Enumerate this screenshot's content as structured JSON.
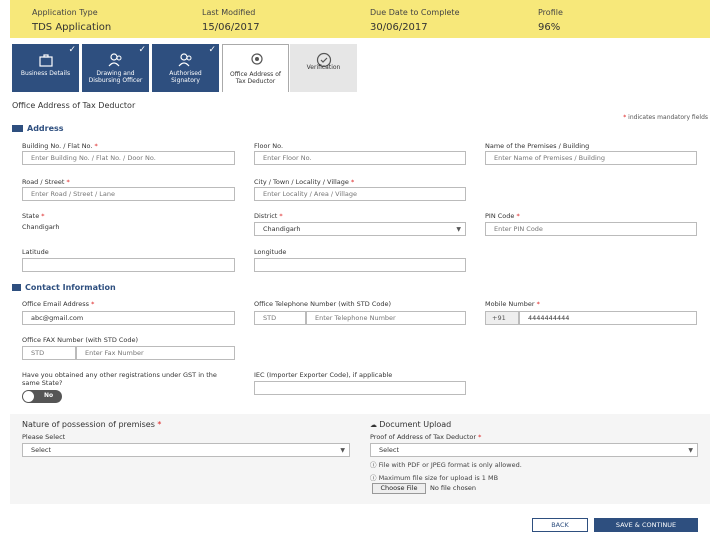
{
  "header": {
    "application_type_label": "Application Type",
    "application_type_value": "TDS Application",
    "last_modified_label": "Last Modified",
    "last_modified_value": "15/06/2017",
    "due_date_label": "Due Date to Complete",
    "due_date_value": "30/06/2017",
    "profile_label": "Profile",
    "profile_value": "96%"
  },
  "tabs": [
    {
      "label": "Business Details",
      "icon": "briefcase-icon",
      "state": "done"
    },
    {
      "label": "Drawing and Disbursing Officer",
      "icon": "users-icon",
      "state": "done"
    },
    {
      "label": "Authorised Signatory",
      "icon": "users-icon",
      "state": "done"
    },
    {
      "label": "Office Address of Tax Deductor",
      "icon": "location-icon",
      "state": "active"
    },
    {
      "label": "Verification",
      "icon": "check-circle-icon",
      "state": "pending"
    }
  ],
  "page_title": "Office Address of Tax Deductor",
  "mandatory_note": "indicates mandatory fields",
  "address": {
    "heading": "Address",
    "building_label": "Building No. / Flat No.",
    "building_placeholder": "Enter Building No. / Flat No. / Door No.",
    "floor_label": "Floor No.",
    "floor_placeholder": "Enter Floor No.",
    "premises_label": "Name of the Premises / Building",
    "premises_placeholder": "Enter Name of Premises / Building",
    "road_label": "Road / Street",
    "road_placeholder": "Enter Road / Street / Lane",
    "city_label": "City / Town / Locality / Village",
    "city_placeholder": "Enter Locality / Area / Village",
    "state_label": "State",
    "state_value": "Chandigarh",
    "district_label": "District",
    "district_value": "Chandigarh",
    "pin_label": "PIN Code",
    "pin_placeholder": "Enter PIN Code",
    "latitude_label": "Latitude",
    "longitude_label": "Longitude"
  },
  "contact": {
    "heading": "Contact Information",
    "email_label": "Office Email Address",
    "email_value": "abc@gmail.com",
    "telephone_label": "Office Telephone Number (with STD Code)",
    "std_placeholder": "STD",
    "telephone_placeholder": "Enter Telephone Number",
    "mobile_label": "Mobile Number",
    "mobile_prefix": "+91",
    "mobile_value": "4444444444",
    "fax_label": "Office FAX Number (with STD Code)",
    "fax_std_placeholder": "STD",
    "fax_placeholder": "Enter Fax Number"
  },
  "gst_question": "Have you obtained any other registrations under GST in the same State?",
  "gst_toggle": "No",
  "iec_label": "IEC (Importer Exporter Code), if applicable",
  "possession": {
    "heading": "Nature of possession of premises",
    "sub_label": "Please Select",
    "select_value": "Select"
  },
  "upload": {
    "heading": "Document Upload",
    "proof_label": "Proof of Address of Tax Deductor",
    "select_value": "Select",
    "note1": "File with PDF or JPEG format is only allowed.",
    "note2": "Maximum file size for upload is 1 MB",
    "choose_file": "Choose File",
    "no_file": "No file chosen"
  },
  "buttons": {
    "back": "BACK",
    "save": "SAVE & CONTINUE"
  }
}
